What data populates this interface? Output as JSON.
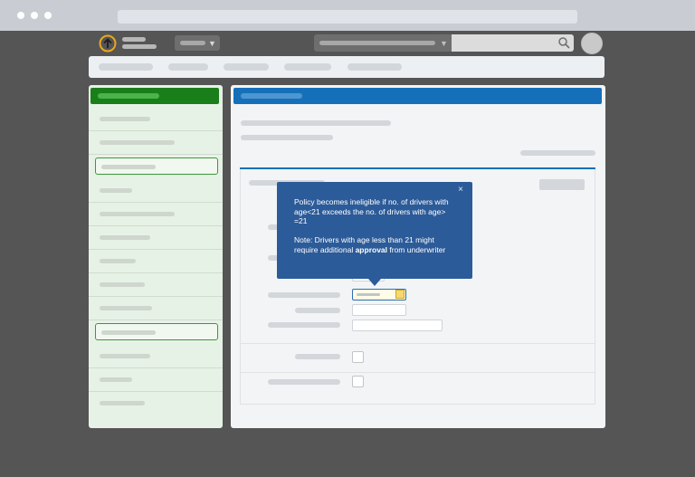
{
  "browser": {
    "window_controls": [
      "close-dot",
      "minimize-dot",
      "maximize-dot"
    ]
  },
  "header": {
    "logo_icon": "circle-arrow-up-icon",
    "logo_color": "#e8a820",
    "search_icon": "search-icon",
    "dropdown_icon": "chevron-down-icon"
  },
  "colors": {
    "sidebar_accent": "#1a7f1a",
    "main_accent": "#1670b9",
    "tooltip_bg": "#2c5b99"
  },
  "tooltip": {
    "close_label": "×",
    "line1": "Policy becomes ineligible if no. of drivers with age<21 exceeds the no. of drivers with age> =21",
    "note_prefix": "Note: Drivers with age less than 21 might require additional ",
    "note_bold": "approval",
    "note_suffix": " from underwriter"
  }
}
